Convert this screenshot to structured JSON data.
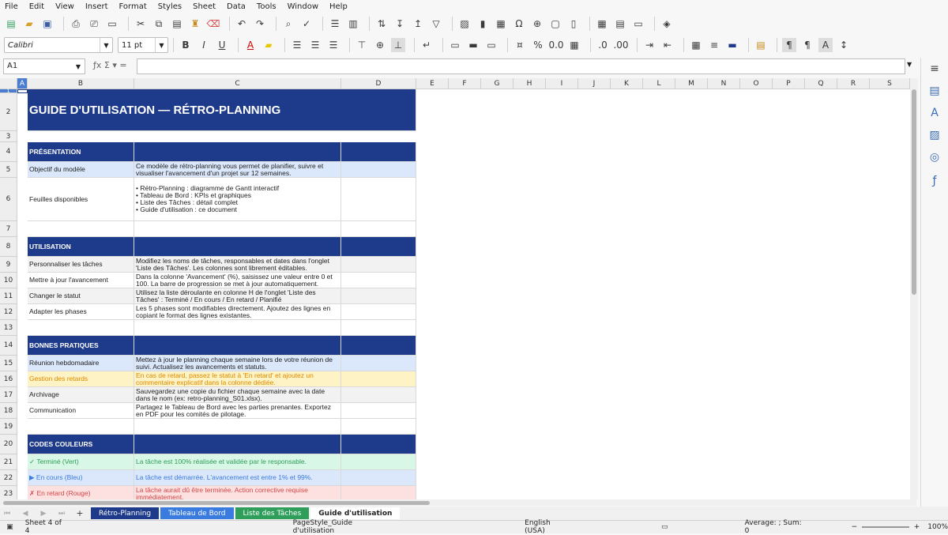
{
  "menu": [
    "File",
    "Edit",
    "View",
    "Insert",
    "Format",
    "Styles",
    "Sheet",
    "Data",
    "Tools",
    "Window",
    "Help"
  ],
  "font": {
    "name": "Calibri",
    "size": "11 pt"
  },
  "formula": {
    "cell_ref": "A1",
    "value": ""
  },
  "columns": [
    "A",
    "B",
    "C",
    "D",
    "E",
    "F",
    "G",
    "H",
    "I",
    "J",
    "K",
    "L",
    "M",
    "N",
    "O",
    "P",
    "Q",
    "R",
    "S"
  ],
  "title": "GUIDE D'UTILISATION — RÉTRO-PLANNING",
  "sections": {
    "presentation": "PRÉSENTATION",
    "utilisation": "UTILISATION",
    "bonnes_pratiques": "BONNES PRATIQUES",
    "codes_couleurs": "CODES COULEURS"
  },
  "rows": {
    "r5": {
      "b": "Objectif du modèle",
      "c": "Ce modèle de rétro-planning vous permet de planifier, suivre et visualiser l'avancement d'un projet sur 12 semaines."
    },
    "r6": {
      "b": "Feuilles disponibles",
      "c": "• Rétro-Planning : diagramme de Gantt interactif\n• Tableau de Bord : KPIs et graphiques\n• Liste des Tâches : détail complet\n• Guide d'utilisation : ce document"
    },
    "r9": {
      "b": "Personnaliser les tâches",
      "c": "Modifiez les noms de tâches, responsables et dates dans l'onglet 'Liste des Tâches'. Les colonnes sont librement éditables."
    },
    "r10": {
      "b": "Mettre à jour l'avancement",
      "c": "Dans la colonne 'Avancement' (%), saisissez une valeur entre 0 et 100. La barre de progression se met à jour automatiquement."
    },
    "r11": {
      "b": "Changer le statut",
      "c": "Utilisez la liste déroulante en colonne H de l'onglet 'Liste des Tâches' : Terminé / En cours / En retard / Planifié"
    },
    "r12": {
      "b": "Adapter les phases",
      "c": "Les 5 phases sont modifiables directement. Ajoutez des lignes en copiant le format des lignes existantes."
    },
    "r15": {
      "b": "Réunion hebdomadaire",
      "c": "Mettez à jour le planning chaque semaine lors de votre réunion de suivi. Actualisez les avancements et statuts."
    },
    "r16": {
      "b": "Gestion des retards",
      "c": "En cas de retard, passez le statut à 'En retard' et ajoutez un commentaire explicatif dans la colonne dédiée."
    },
    "r17": {
      "b": "Archivage",
      "c": "Sauvegardez une copie du fichier chaque semaine avec la date dans le nom (ex: retro-planning_S01.xlsx)."
    },
    "r18": {
      "b": "Communication",
      "c": "Partagez le Tableau de Bord avec les parties prenantes. Exportez en PDF pour les comités de pilotage."
    },
    "r21": {
      "b": "✓ Terminé (Vert)",
      "c": "La tâche est 100% réalisée et validée par le responsable."
    },
    "r22": {
      "b": "▶ En cours (Bleu)",
      "c": "La tâche est démarrée. L'avancement est entre 1% et 99%."
    },
    "r23": {
      "b": "✗ En retard (Rouge)",
      "c": "La tâche aurait dû être terminée. Action corrective requise immédiatement."
    }
  },
  "tabs": [
    "Rétro-Planning",
    "Tableau de Bord",
    "Liste des Tâches",
    "Guide d'utilisation"
  ],
  "status": {
    "sheet": "Sheet 4 of 4",
    "pagestyle": "PageStyle_Guide d'utilisation",
    "language": "English (USA)",
    "summary": "Average: ; Sum: 0",
    "zoom": "100%"
  },
  "colors": {
    "header_blue": "#1e3a8a",
    "light_blue": "#dbe8fb",
    "light_yellow": "#fdf3c4",
    "light_gray": "#f2f2f2",
    "green_bg": "#d9f7e6",
    "green_text": "#2e9e5a",
    "blue_text": "#3a7be0",
    "red_bg": "#fde1e1",
    "red_text": "#d64545",
    "orange_text": "#e08a00"
  }
}
